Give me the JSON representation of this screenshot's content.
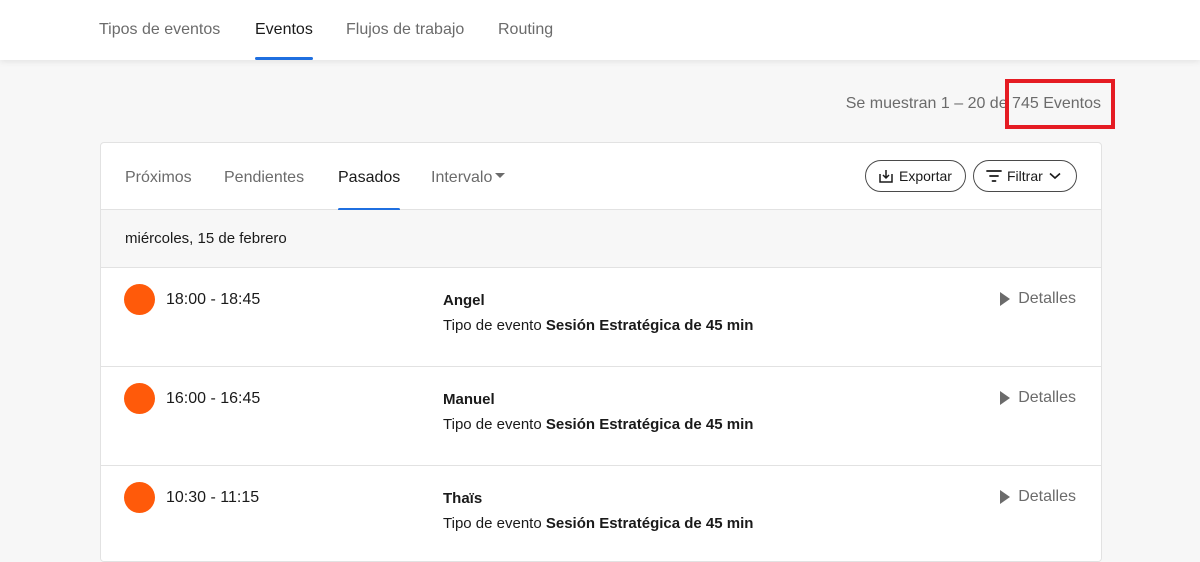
{
  "topnav": {
    "tabs": [
      {
        "label": "Tipos de eventos"
      },
      {
        "label": "Eventos"
      },
      {
        "label": "Flujos de trabajo"
      },
      {
        "label": "Routing"
      }
    ],
    "active_tab": "Eventos"
  },
  "count_text": "Se muestran 1 – 20 de 745 Eventos",
  "highlight_color": "#e51c23",
  "card": {
    "tabs": [
      {
        "label": "Próximos"
      },
      {
        "label": "Pendientes"
      },
      {
        "label": "Pasados"
      },
      {
        "label": "Intervalo"
      }
    ],
    "active_tab": "Pasados",
    "export_label": "Exportar",
    "filter_label": "Filtrar",
    "date_label": "miércoles, 15 de febrero",
    "events": [
      {
        "time": "18:00 - 18:45",
        "name": "Angel",
        "type_prefix": "Tipo de evento",
        "type_name": "Sesión Estratégica de 45 min",
        "details_label": "Detalles"
      },
      {
        "time": "16:00 - 16:45",
        "name": "Manuel",
        "type_prefix": "Tipo de evento",
        "type_name": "Sesión Estratégica de 45 min",
        "details_label": "Detalles"
      },
      {
        "time": "10:30 - 11:15",
        "name": "Thaïs",
        "type_prefix": "Tipo de evento",
        "type_name": "Sesión Estratégica de 45 min",
        "details_label": "Detalles"
      }
    ]
  },
  "colors": {
    "accent": "#1f6fe0",
    "event_dot": "#ff5a0a"
  }
}
